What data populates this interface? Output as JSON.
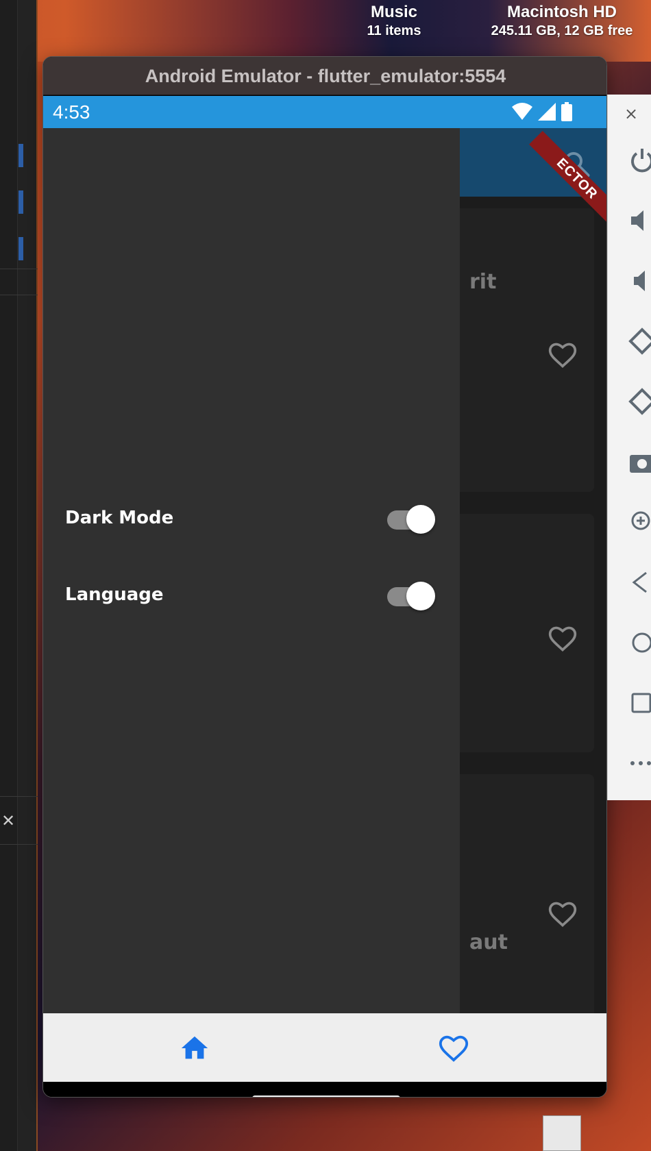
{
  "desktop": {
    "music": {
      "name": "Music",
      "sub": "11 items"
    },
    "hd": {
      "name": "Macintosh HD",
      "sub": "245.11 GB, 12 GB free"
    }
  },
  "window": {
    "title": "Android Emulator - flutter_emulator:5554"
  },
  "statusbar": {
    "time": "4:53"
  },
  "appbar": {
    "banner": "ECTOR"
  },
  "cards": [
    {
      "title_partial": "rit"
    },
    {
      "title_partial": ""
    },
    {
      "title_partial": "aut"
    }
  ],
  "drawer": {
    "settings": [
      {
        "label": "Dark Mode",
        "enabled": true
      },
      {
        "label": "Language",
        "enabled": true
      }
    ]
  },
  "colors": {
    "accent": "#2595dc",
    "appbar": "#16496e",
    "drawer": "#303030",
    "nav_icon": "#1a73e8"
  },
  "icons": {
    "bottom_nav": [
      "home-icon",
      "favorite-outline-icon"
    ],
    "sidebar": [
      "power-icon",
      "volume-up-icon",
      "volume-down-icon",
      "rotate-left-icon",
      "rotate-right-icon",
      "camera-icon",
      "zoom-icon",
      "back-icon",
      "home-circle-icon",
      "overview-icon",
      "more-icon"
    ]
  }
}
